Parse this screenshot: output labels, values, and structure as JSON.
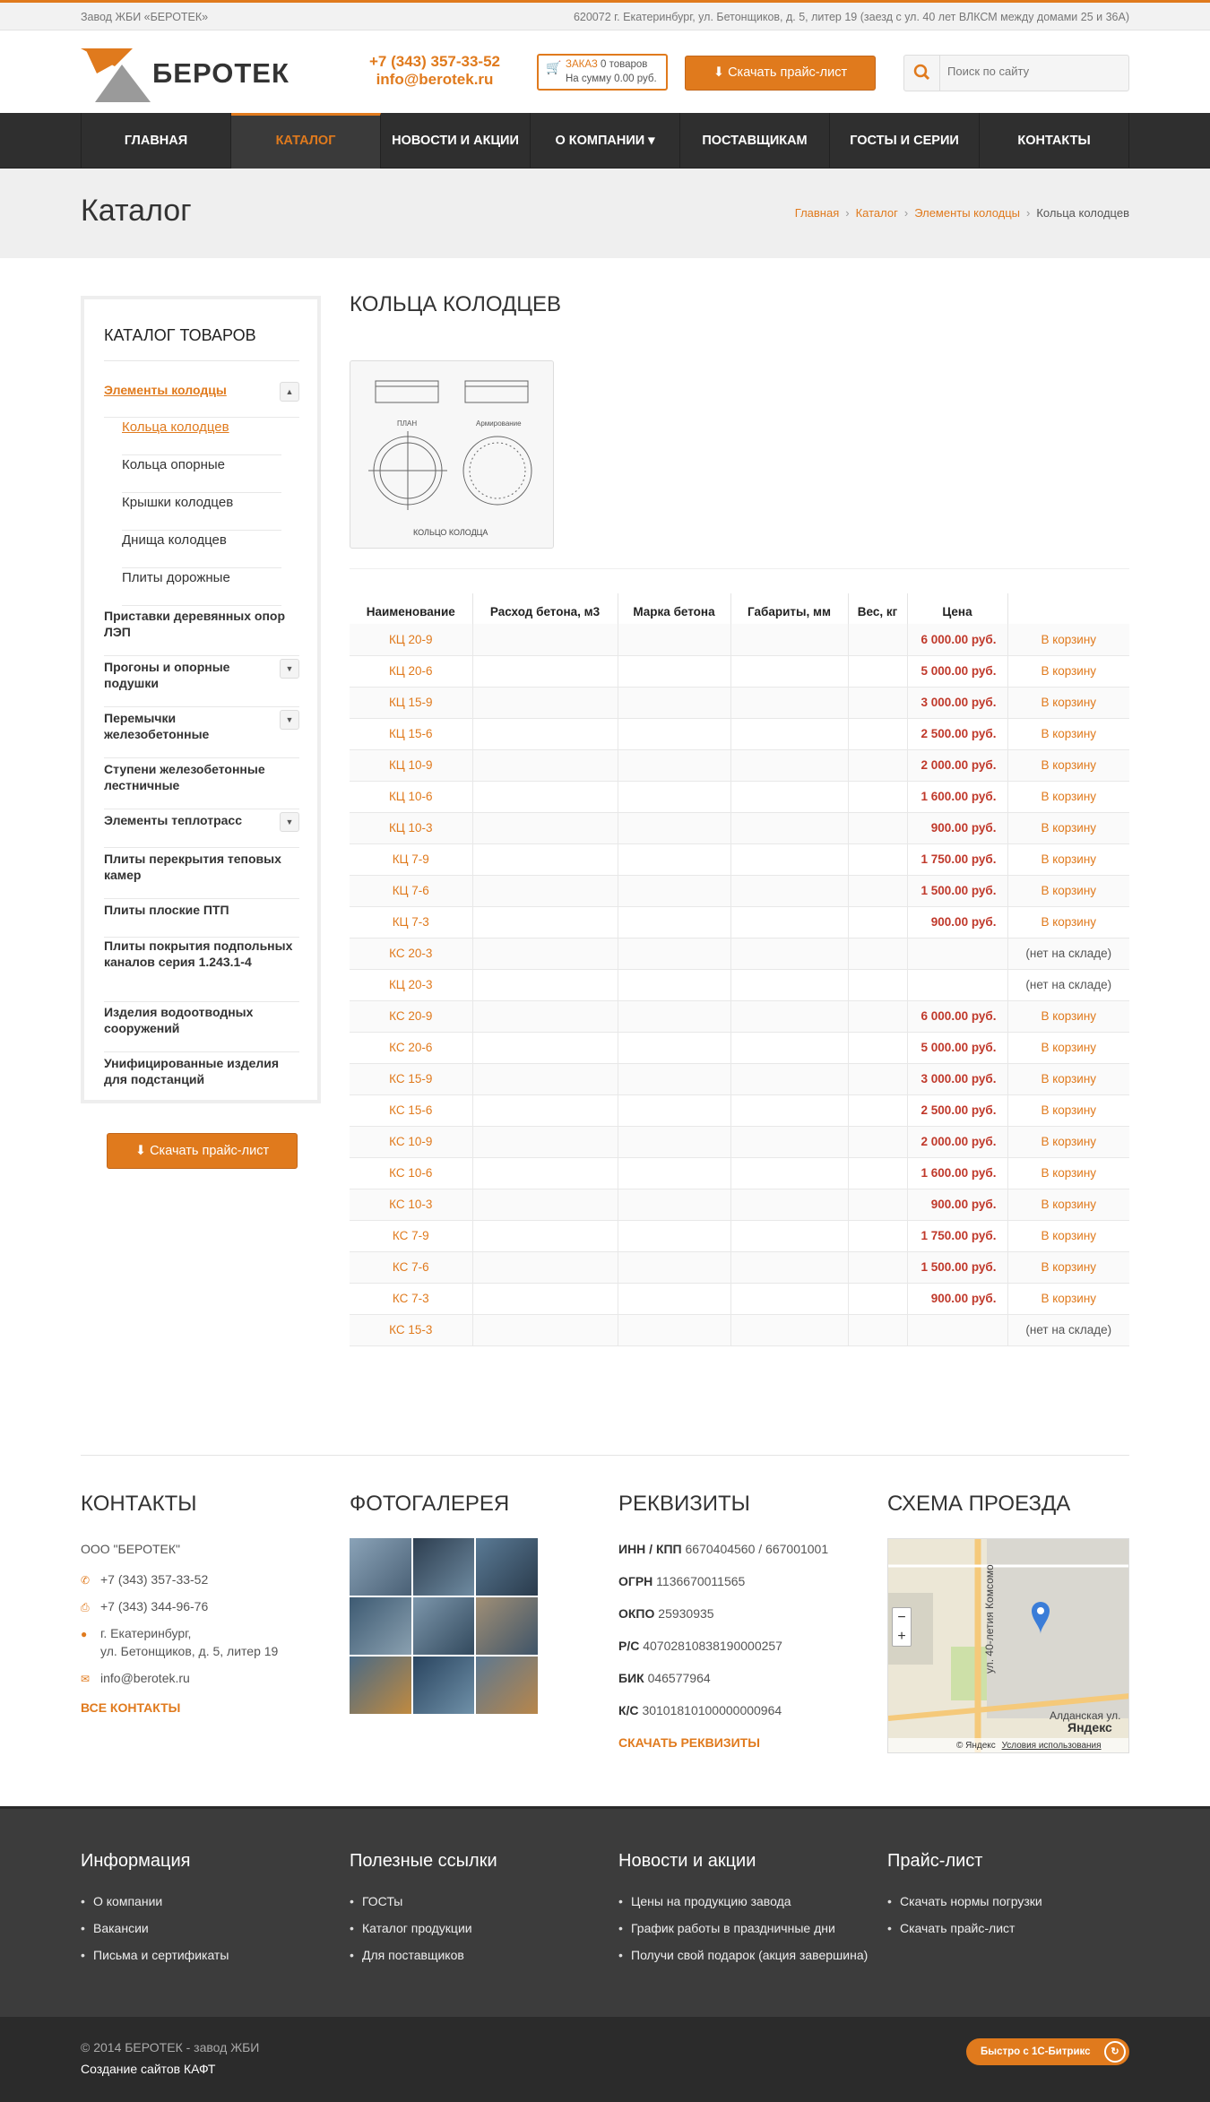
{
  "topbar": {
    "company": "Завод ЖБИ «БЕРОТЕК»",
    "address": "620072 г. Екатеринбург, ул. Бетонщиков, д. 5, литер 19 (заезд с ул. 40 лет ВЛКСМ между домами 25 и 36А)"
  },
  "header": {
    "logo_text": "БЕРОТЕК",
    "phone": "+7 (343) 357-33-52",
    "email": "info@berotek.ru",
    "cart": {
      "label": "ЗАКАЗ",
      "count": "0 товаров",
      "sum_prefix": "На сумму",
      "sum": "0.00 руб."
    },
    "price_button": "Скачать прайс-лист",
    "search_placeholder": "Поиск по сайту"
  },
  "nav": [
    "Главная",
    "Каталог",
    "Новости и акции",
    "О компании ▾",
    "Поставщикам",
    "ГОСТы и серии",
    "Контакты"
  ],
  "page_title": "Каталог",
  "breadcrumbs": [
    "Главная",
    "Каталог",
    "Элементы колодцы",
    "Кольца колодцев"
  ],
  "sidebar": {
    "title": "КАТАЛОГ ТОВАРОВ",
    "items": [
      {
        "label": "Элементы колодцы",
        "toggle": "▲"
      },
      {
        "label": "Кольца колодцев"
      },
      {
        "label": "Кольца опорные"
      },
      {
        "label": "Крышки колодцев"
      },
      {
        "label": "Днища колодцев"
      },
      {
        "label": "Плиты дорожные"
      },
      {
        "label": "Приставки деревянных опор ЛЭП"
      },
      {
        "label": "Прогоны и опорные подушки",
        "toggle": "▼"
      },
      {
        "label": "Перемычки железобетонные",
        "toggle": "▼"
      },
      {
        "label": "Ступени железобетонные лестничные"
      },
      {
        "label": "Элементы теплотрасс",
        "toggle": "▼"
      },
      {
        "label": "Плиты перекрытия теповых камер"
      },
      {
        "label": "Плиты плоские ПТП"
      },
      {
        "label": "Плиты покрытия подпольных каналов серия 1.243.1-4"
      },
      {
        "label": "Изделия водоотводных сооружений"
      },
      {
        "label": "Унифицированные изделия для подстанций"
      }
    ],
    "button": "Скачать прайс-лист"
  },
  "content": {
    "title": "КОЛЬЦА КОЛОДЦЕВ",
    "drawing_labels": {
      "plan": "ПЛАН",
      "arm": "Армирование",
      "caption": "КОЛЬЦО КОЛОДЦА"
    },
    "columns": [
      "Наименование",
      "Расход бетона, м3",
      "Марка бетона",
      "Габариты, мм",
      "Вес, кг",
      "Цена",
      ""
    ],
    "rows": [
      {
        "name": "КЦ 20-9",
        "price": "6 000.00 руб.",
        "action": "В корзину"
      },
      {
        "name": "КЦ 20-6",
        "price": "5 000.00 руб.",
        "action": "В корзину"
      },
      {
        "name": "КЦ 15-9",
        "price": "3 000.00 руб.",
        "action": "В корзину"
      },
      {
        "name": "КЦ 15-6",
        "price": "2 500.00 руб.",
        "action": "В корзину"
      },
      {
        "name": "КЦ 10-9",
        "price": "2 000.00 руб.",
        "action": "В корзину"
      },
      {
        "name": "КЦ 10-6",
        "price": "1 600.00 руб.",
        "action": "В корзину"
      },
      {
        "name": "КЦ 10-3",
        "price": "900.00 руб.",
        "action": "В корзину"
      },
      {
        "name": "КЦ 7-9",
        "price": "1 750.00 руб.",
        "action": "В корзину"
      },
      {
        "name": "КЦ 7-6",
        "price": "1 500.00 руб.",
        "action": "В корзину"
      },
      {
        "name": "КЦ 7-3",
        "price": "900.00 руб.",
        "action": "В корзину"
      },
      {
        "name": "КС 20-3",
        "price": "",
        "action": "(нет на складе)"
      },
      {
        "name": "КЦ 20-3",
        "price": "",
        "action": "(нет на складе)"
      },
      {
        "name": "КС 20-9",
        "price": "6 000.00 руб.",
        "action": "В корзину"
      },
      {
        "name": "КС 20-6",
        "price": "5 000.00 руб.",
        "action": "В корзину"
      },
      {
        "name": "КС 15-9",
        "price": "3 000.00 руб.",
        "action": "В корзину"
      },
      {
        "name": "КС 15-6",
        "price": "2 500.00 руб.",
        "action": "В корзину"
      },
      {
        "name": "КС 10-9",
        "price": "2 000.00 руб.",
        "action": "В корзину"
      },
      {
        "name": "КС 10-6",
        "price": "1 600.00 руб.",
        "action": "В корзину"
      },
      {
        "name": "КС 10-3",
        "price": "900.00 руб.",
        "action": "В корзину"
      },
      {
        "name": "КС 7-9",
        "price": "1 750.00 руб.",
        "action": "В корзину"
      },
      {
        "name": "КС 7-6",
        "price": "1 500.00 руб.",
        "action": "В корзину"
      },
      {
        "name": "КС 7-3",
        "price": "900.00 руб.",
        "action": "В корзину"
      },
      {
        "name": "КС 15-3",
        "price": "",
        "action": "(нет на складе)"
      }
    ]
  },
  "footer": {
    "contacts": {
      "title": "КОНТАКТЫ",
      "company": "ООО \"БЕРОТЕК\"",
      "phone1": "+7 (343) 357-33-52",
      "phone2": "+7 (343) 344-96-76",
      "addr1": "г. Екатеринбург,",
      "addr2": "ул. Бетонщиков, д. 5, литер 19",
      "email": "info@berotek.ru",
      "all": "ВСЕ КОНТАКТЫ"
    },
    "gallery": {
      "title": "ФОТОГАЛЕРЕЯ"
    },
    "requisites": {
      "title": "РЕКВИЗИТЫ",
      "items": [
        {
          "k": "ИНН / КПП",
          "v": "6670404560 / 667001001"
        },
        {
          "k": "ОГРН",
          "v": "1136670011565"
        },
        {
          "k": "ОКПО",
          "v": "25930935"
        },
        {
          "k": "Р/С",
          "v": "40702810838190000257"
        },
        {
          "k": "БИК",
          "v": "046577964"
        },
        {
          "k": "К/С",
          "v": "30101810100000000964"
        }
      ],
      "download": "СКАЧАТЬ РЕКВИЗИТЫ"
    },
    "map": {
      "title": "СХЕМА ПРОЕЗДА",
      "street1": "ул. 40-летия Комсомо",
      "street2": "Алданская ул.",
      "brand": "Яндекс",
      "yandex": "© Яндекс",
      "terms": "Условия использования"
    }
  },
  "dark_footer": {
    "cols": [
      {
        "title": "Информация",
        "links": [
          "О компании",
          "Вакансии",
          "Письма и сертификаты"
        ]
      },
      {
        "title": "Полезные ссылки",
        "links": [
          "ГОСТы",
          "Каталог продукции",
          "Для поставщиков"
        ]
      },
      {
        "title": "Новости и акции",
        "links": [
          "Цены на продукцию завода",
          "График работы в праздничные дни",
          "Получи свой подарок (акция завершина)"
        ]
      },
      {
        "title": "Прайс-лист",
        "links": [
          "Скачать нормы погрузки",
          "Скачать прайс-лист"
        ]
      }
    ],
    "copyright": "© 2014 БЕРОТЕК - завод ЖБИ",
    "made_by": "Создание сайтов КАФТ",
    "bitrix": "Быстро с 1С-Битрикс"
  },
  "colors": {
    "accent": "#e07a1d",
    "price": "#c0392b",
    "nav_bg": "#2f2f2f"
  }
}
